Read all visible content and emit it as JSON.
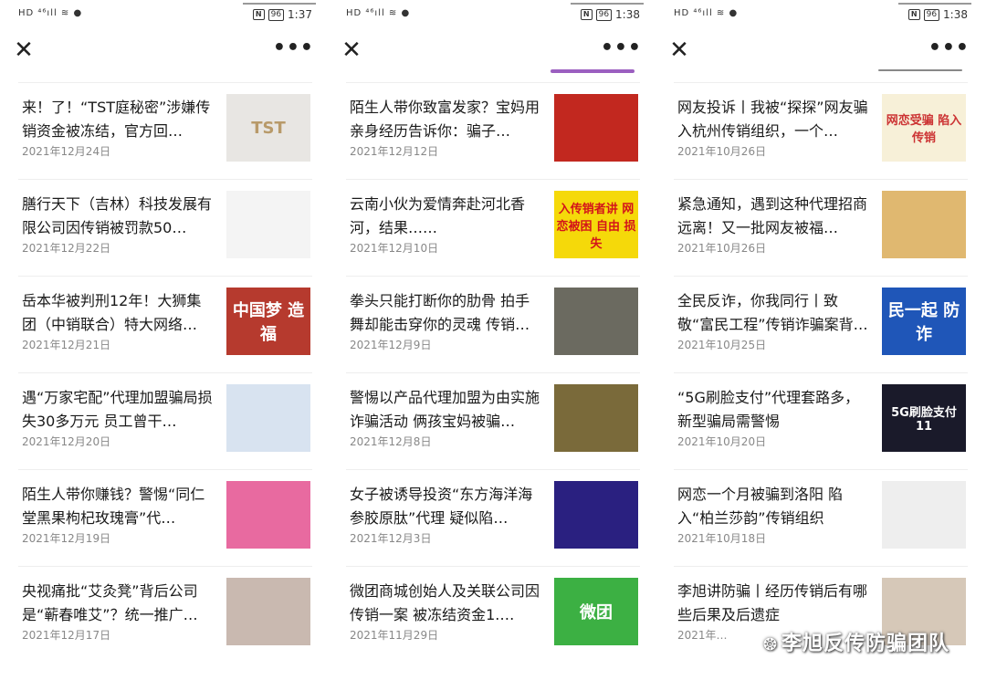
{
  "panels": [
    {
      "status": {
        "signal": "HD ⁴⁶ıll ≋ ●",
        "nfc": "N",
        "battery": "96",
        "time": "1:37"
      },
      "nav": {
        "close": "✕",
        "more": "•••"
      },
      "progress_color": "#ffffff",
      "items": [
        {
          "title": "来！了！“TST庭秘密”涉嫌传销资金被冻结，官方回…",
          "date": "2021年12月24日",
          "thumb": "TST",
          "bg": "#e8e6e3",
          "fg": "#b89a6a"
        },
        {
          "title": "膳行天下（吉林）科技发展有限公司因传销被罚款50…",
          "date": "2021年12月22日",
          "thumb": "",
          "bg": "#f4f4f4",
          "fg": "#c33"
        },
        {
          "title": "岳本华被判刑12年！大狮集团（中销联合）特大网络…",
          "date": "2021年12月21日",
          "thumb": "中国梦 造福",
          "bg": "#b63a2e",
          "fg": "#fff"
        },
        {
          "title": "遇“万家宅配”代理加盟骗局损失30多万元 员工曾干…",
          "date": "2021年12月20日",
          "thumb": "",
          "bg": "#d8e3f0",
          "fg": "#2a5fa8"
        },
        {
          "title": "陌生人带你赚钱？警惕“同仁堂黑果枸杞玫瑰膏”代…",
          "date": "2021年12月19日",
          "thumb": "",
          "bg": "#e86aa0",
          "fg": "#fff"
        },
        {
          "title": "央视痛批“艾灸凳”背后公司是“蕲春唯艾”？统一推广…",
          "date": "2021年12月17日",
          "thumb": "",
          "bg": "#c9b9b0",
          "fg": "#333"
        }
      ]
    },
    {
      "status": {
        "signal": "HD ⁴⁶ıll ≋ ●",
        "nfc": "N",
        "battery": "96",
        "time": "1:38"
      },
      "nav": {
        "close": "✕",
        "more": "•••"
      },
      "progress_color": "#9b5fc0",
      "items": [
        {
          "title": "陌生人带你致富发家？宝妈用亲身经历告诉你：骗子…",
          "date": "2021年12月12日",
          "thumb": "",
          "bg": "#c2281f",
          "fg": "#fff"
        },
        {
          "title": "云南小伙为爱情奔赴河北香河，结果……",
          "date": "2021年12月10日",
          "thumb": "入传销者讲 网恋被困 自由 损失",
          "bg": "#f5d90a",
          "fg": "#d3141a"
        },
        {
          "title": "拳头只能打断你的肋骨 拍手舞却能击穿你的灵魂 传销…",
          "date": "2021年12月9日",
          "thumb": "",
          "bg": "#6b6a60",
          "fg": "#fff"
        },
        {
          "title": "警惕以产品代理加盟为由实施诈骗活动 俩孩宝妈被骗…",
          "date": "2021年12月8日",
          "thumb": "",
          "bg": "#7a6a3a",
          "fg": "#f0d070"
        },
        {
          "title": "女子被诱导投资“东方海洋海参胶原肽”代理 疑似陷…",
          "date": "2021年12月3日",
          "thumb": "",
          "bg": "#2a2080",
          "fg": "#f0c040"
        },
        {
          "title": "微团商城创始人及关联公司因传销一案 被冻结资金1.…",
          "date": "2021年11月29日",
          "thumb": "微团",
          "bg": "#3cb043",
          "fg": "#fff"
        }
      ]
    },
    {
      "status": {
        "signal": "HD ⁴⁶ıll ≋ ●",
        "nfc": "N",
        "battery": "96",
        "time": "1:38"
      },
      "nav": {
        "close": "✕",
        "more": "•••"
      },
      "progress_color": "#888888",
      "items": [
        {
          "title": "网友投诉丨我被“探探”网友骗入杭州传销组织，一个…",
          "date": "2021年10月26日",
          "thumb": "网恋受骗 陷入传销",
          "bg": "#f7f0d8",
          "fg": "#c33"
        },
        {
          "title": "紧急通知，遇到这种代理招商远离！又一批网友被福…",
          "date": "2021年10月26日",
          "thumb": "",
          "bg": "#e0b870",
          "fg": "#a33"
        },
        {
          "title": "全民反诈，你我同行丨致敬“富民工程”传销诈骗案背…",
          "date": "2021年10月25日",
          "thumb": "民一起 防诈",
          "bg": "#1f56b8",
          "fg": "#fff"
        },
        {
          "title": "“5G刷脸支付”代理套路多，新型骗局需警惕",
          "date": "2021年10月20日",
          "thumb": "5G刷脸支付 11",
          "bg": "#1a1a2a",
          "fg": "#fff"
        },
        {
          "title": "网恋一个月被骗到洛阳 陷入“柏兰莎韵”传销组织",
          "date": "2021年10月18日",
          "thumb": "",
          "bg": "#eeeeee",
          "fg": "#c33"
        },
        {
          "title": "李旭讲防骗丨经历传销后有哪些后果及后遗症",
          "date": "2021年…",
          "thumb": "",
          "bg": "#d6c8b8",
          "fg": "#333"
        }
      ]
    }
  ],
  "watermark": {
    "icon": "wechat-icon",
    "text": "李旭反传防骗团队"
  }
}
